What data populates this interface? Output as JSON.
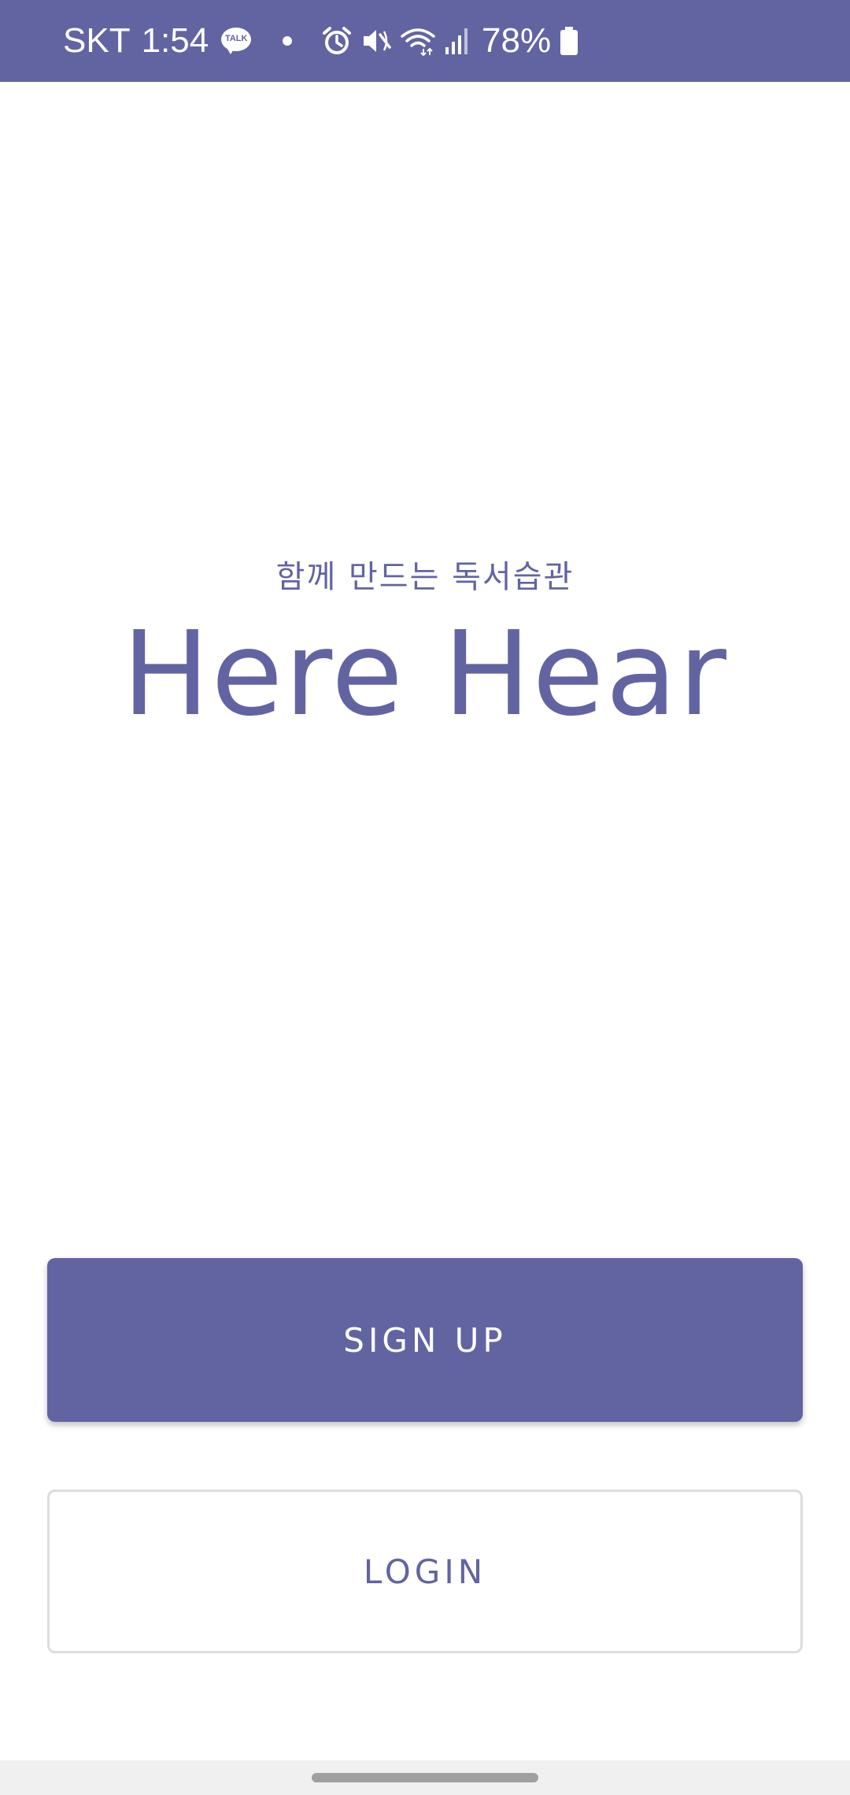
{
  "status_bar": {
    "carrier": "SKT",
    "time": "1:54",
    "talk_badge": "TALK",
    "battery": "78%",
    "icons": [
      "kakaotalk-icon",
      "dot-icon",
      "alarm-icon",
      "mute-icon",
      "wifi-icon",
      "signal-icon",
      "battery-icon"
    ],
    "background_color": "#6264a2"
  },
  "main": {
    "tagline": "함께 만드는 독서습관",
    "app_title": "Here Hear",
    "accent_color": "#6264a2"
  },
  "buttons": {
    "signup_label": "SIGN UP",
    "login_label": "LOGIN"
  }
}
